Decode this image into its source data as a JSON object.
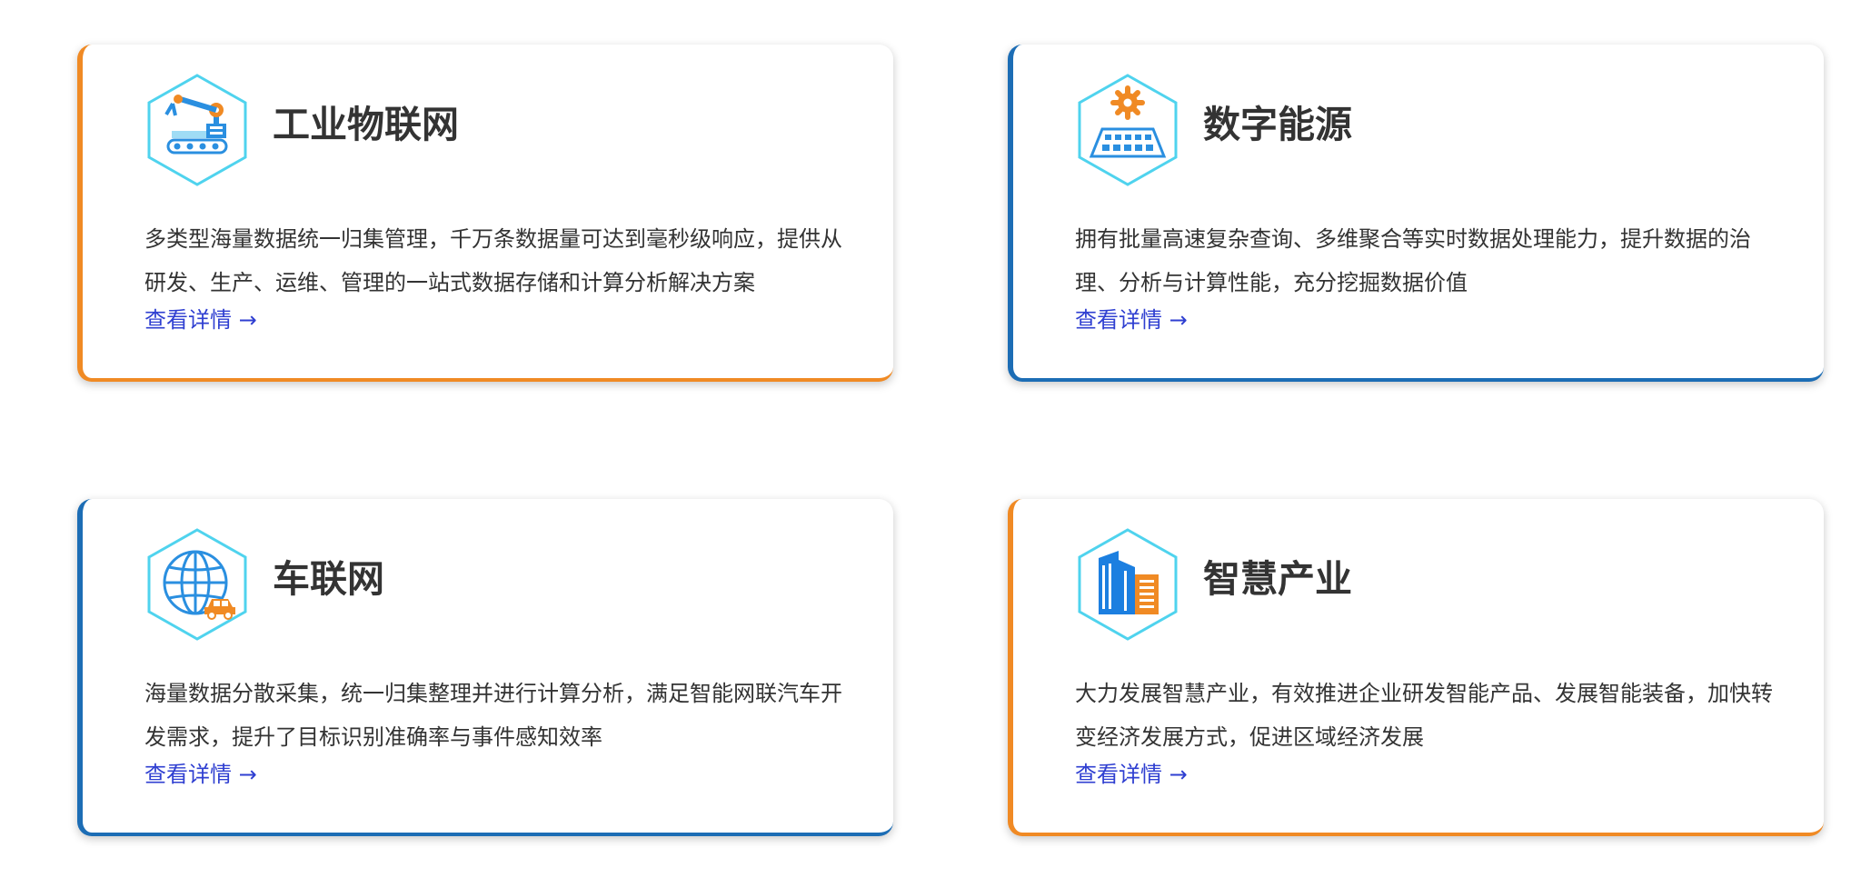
{
  "cards": [
    {
      "title": "工业物联网",
      "description": "多类型海量数据统一归集管理，千万条数据量可达到毫秒级响应，提供从研发、生产、运维、管理的一站式数据存储和计算分析解决方案",
      "link": "查看详情 →",
      "accent": "#f08a24",
      "icon": "robot-arm-icon"
    },
    {
      "title": "数字能源",
      "description": "拥有批量高速复杂查询、多维聚合等实时数据处理能力，提升数据的治理、分析与计算性能，充分挖掘数据价值",
      "link": "查看详情 →",
      "accent": "#1c6db5",
      "icon": "solar-panel-icon"
    },
    {
      "title": "车联网",
      "description": "海量数据分散采集，统一归集整理并进行计算分析，满足智能网联汽车开发需求，提升了目标识别准确率与事件感知效率",
      "link": "查看详情 →",
      "accent": "#1c6db5",
      "icon": "globe-car-icon"
    },
    {
      "title": "智慧产业",
      "description": "大力发展智慧产业，有效推进企业研发智能产品、发展智能装备，加快转变经济发展方式，促进区域经济发展",
      "link": "查看详情 →",
      "accent": "#f08a24",
      "icon": "buildings-icon"
    }
  ]
}
